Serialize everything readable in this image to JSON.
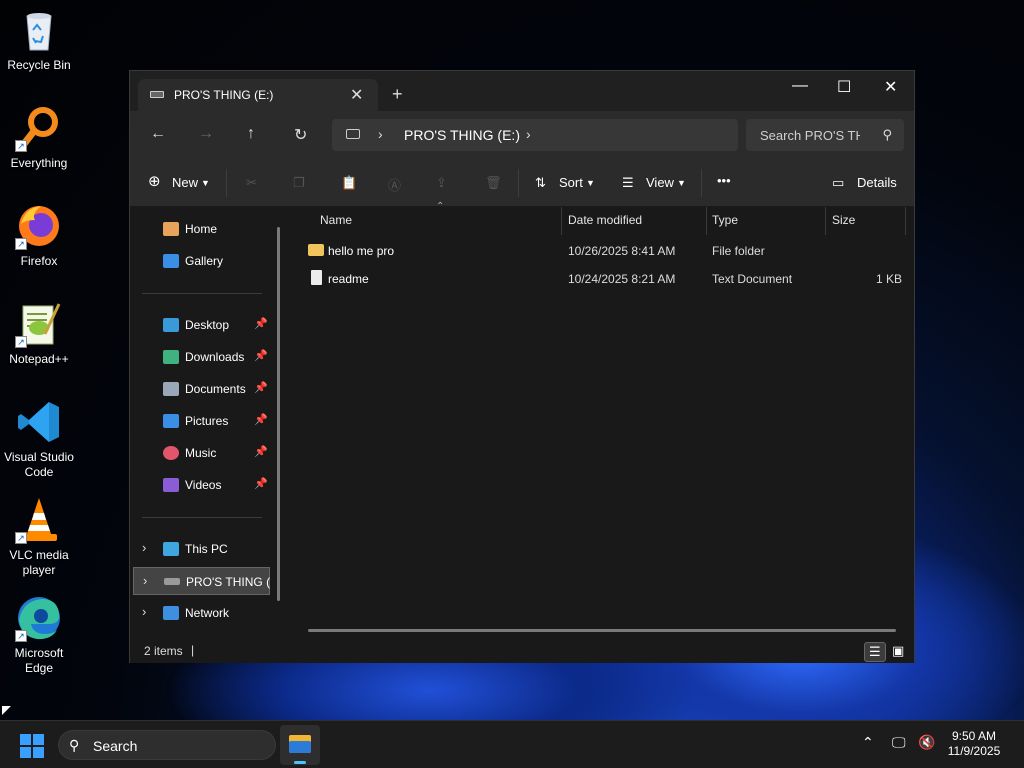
{
  "desktop": {
    "icons": [
      {
        "label": "Recycle Bin",
        "icon": "recycle-bin-icon"
      },
      {
        "label": "Everything",
        "icon": "everything-search-icon"
      },
      {
        "label": "Firefox",
        "icon": "firefox-icon"
      },
      {
        "label": "Notepad++",
        "icon": "notepad-plus-plus-icon"
      },
      {
        "label": "Visual Studio Code",
        "icon": "vscode-icon"
      },
      {
        "label": "VLC media player",
        "icon": "vlc-icon"
      },
      {
        "label": "Microsoft Edge",
        "icon": "edge-icon"
      }
    ]
  },
  "window": {
    "tab_title": "PRO'S THING (E:)",
    "new_tab": "+",
    "minimize": "—",
    "maximize": "☐",
    "close": "✕"
  },
  "nav": {
    "back": "←",
    "forward": "→",
    "up": "↑",
    "refresh": "↻",
    "breadcrumb": "PRO'S THING (E:)",
    "search_placeholder": "Search PRO'S THING (E:)"
  },
  "toolbar": {
    "new_label": "New",
    "sort_label": "Sort",
    "view_label": "View",
    "more_label": "•••",
    "details_label": "Details"
  },
  "sidebar": {
    "quick": [
      {
        "label": "Home",
        "icon": "home-icon",
        "color": "#e8a35a"
      },
      {
        "label": "Gallery",
        "icon": "gallery-icon",
        "color": "#3a8ee6"
      }
    ],
    "pinned": [
      {
        "label": "Desktop",
        "icon": "desktop-folder-icon",
        "color": "#3a9ad9"
      },
      {
        "label": "Downloads",
        "icon": "downloads-icon",
        "color": "#3fb27f"
      },
      {
        "label": "Documents",
        "icon": "documents-icon",
        "color": "#9aa7b8"
      },
      {
        "label": "Pictures",
        "icon": "pictures-icon",
        "color": "#3a8ee6"
      },
      {
        "label": "Music",
        "icon": "music-icon",
        "color": "#e2566b"
      },
      {
        "label": "Videos",
        "icon": "videos-icon",
        "color": "#8a5cd6"
      }
    ],
    "tree": [
      {
        "label": "This PC",
        "icon": "this-pc-icon",
        "color": "#3fa6e0"
      },
      {
        "label": "PRO'S THING (E:)",
        "icon": "drive-icon",
        "color": "#9a9a9a",
        "selected": true
      },
      {
        "label": "Network",
        "icon": "network-icon",
        "color": "#3f8fe0"
      }
    ],
    "pin_glyph": "📌"
  },
  "columns": {
    "name": "Name",
    "date": "Date modified",
    "type": "Type",
    "size": "Size"
  },
  "files": [
    {
      "name": "hello me pro",
      "date": "10/26/2025 8:41 AM",
      "type": "File folder",
      "size": "",
      "icon": "folder-icon"
    },
    {
      "name": "readme",
      "date": "10/24/2025 8:21 AM",
      "type": "Text Document",
      "size": "1 KB",
      "icon": "text-document-icon"
    }
  ],
  "status": {
    "count": "2 items"
  },
  "taskbar": {
    "search_label": "Search",
    "time": "9:50 AM",
    "date": "11/9/2025"
  }
}
